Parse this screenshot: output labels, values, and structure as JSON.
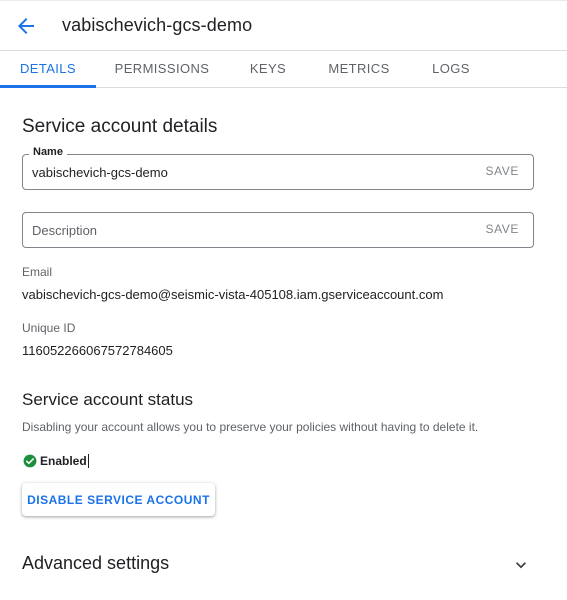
{
  "header": {
    "title": "vabischevich-gcs-demo",
    "back_icon": "arrow-back-icon"
  },
  "tabs": [
    {
      "label": "DETAILS",
      "active": true
    },
    {
      "label": "PERMISSIONS",
      "active": false
    },
    {
      "label": "KEYS",
      "active": false
    },
    {
      "label": "METRICS",
      "active": false
    },
    {
      "label": "LOGS",
      "active": false
    }
  ],
  "details": {
    "heading": "Service account details",
    "name_field": {
      "label": "Name",
      "value": "vabischevich-gcs-demo",
      "save_label": "SAVE"
    },
    "description_field": {
      "placeholder": "Description",
      "value": "",
      "save_label": "SAVE"
    },
    "email_label": "Email",
    "email_value": "vabischevich-gcs-demo@seismic-vista-405108.iam.gserviceaccount.com",
    "unique_id_label": "Unique ID",
    "unique_id_value": "116052266067572784605"
  },
  "status_section": {
    "heading": "Service account status",
    "description": "Disabling your account allows you to preserve your policies without having to delete it.",
    "status_text": "Enabled",
    "status_icon": "check-circle-icon",
    "disable_button_label": "DISABLE SERVICE ACCOUNT"
  },
  "advanced": {
    "heading": "Advanced settings",
    "expand_icon": "chevron-down-icon"
  },
  "colors": {
    "accent": "#1a73e8",
    "success": "#1e8e3e",
    "text": "#202124",
    "secondary_text": "#5f6368"
  }
}
